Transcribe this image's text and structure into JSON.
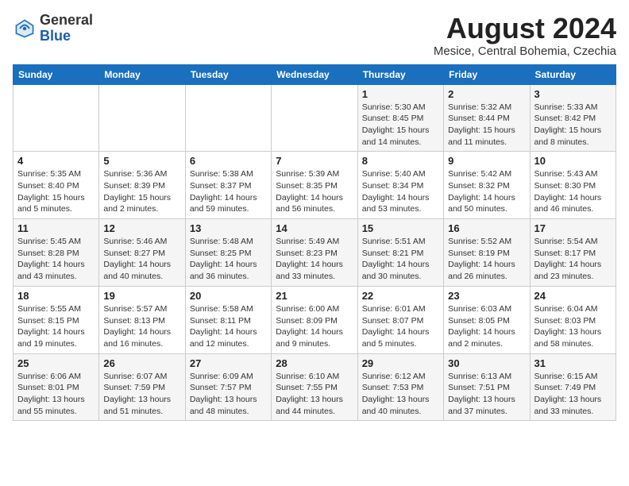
{
  "header": {
    "logo_line1": "General",
    "logo_line2": "Blue",
    "month_year": "August 2024",
    "location": "Mesice, Central Bohemia, Czechia"
  },
  "weekdays": [
    "Sunday",
    "Monday",
    "Tuesday",
    "Wednesday",
    "Thursday",
    "Friday",
    "Saturday"
  ],
  "weeks": [
    [
      {
        "day": "",
        "info": ""
      },
      {
        "day": "",
        "info": ""
      },
      {
        "day": "",
        "info": ""
      },
      {
        "day": "",
        "info": ""
      },
      {
        "day": "1",
        "info": "Sunrise: 5:30 AM\nSunset: 8:45 PM\nDaylight: 15 hours\nand 14 minutes."
      },
      {
        "day": "2",
        "info": "Sunrise: 5:32 AM\nSunset: 8:44 PM\nDaylight: 15 hours\nand 11 minutes."
      },
      {
        "day": "3",
        "info": "Sunrise: 5:33 AM\nSunset: 8:42 PM\nDaylight: 15 hours\nand 8 minutes."
      }
    ],
    [
      {
        "day": "4",
        "info": "Sunrise: 5:35 AM\nSunset: 8:40 PM\nDaylight: 15 hours\nand 5 minutes."
      },
      {
        "day": "5",
        "info": "Sunrise: 5:36 AM\nSunset: 8:39 PM\nDaylight: 15 hours\nand 2 minutes."
      },
      {
        "day": "6",
        "info": "Sunrise: 5:38 AM\nSunset: 8:37 PM\nDaylight: 14 hours\nand 59 minutes."
      },
      {
        "day": "7",
        "info": "Sunrise: 5:39 AM\nSunset: 8:35 PM\nDaylight: 14 hours\nand 56 minutes."
      },
      {
        "day": "8",
        "info": "Sunrise: 5:40 AM\nSunset: 8:34 PM\nDaylight: 14 hours\nand 53 minutes."
      },
      {
        "day": "9",
        "info": "Sunrise: 5:42 AM\nSunset: 8:32 PM\nDaylight: 14 hours\nand 50 minutes."
      },
      {
        "day": "10",
        "info": "Sunrise: 5:43 AM\nSunset: 8:30 PM\nDaylight: 14 hours\nand 46 minutes."
      }
    ],
    [
      {
        "day": "11",
        "info": "Sunrise: 5:45 AM\nSunset: 8:28 PM\nDaylight: 14 hours\nand 43 minutes."
      },
      {
        "day": "12",
        "info": "Sunrise: 5:46 AM\nSunset: 8:27 PM\nDaylight: 14 hours\nand 40 minutes."
      },
      {
        "day": "13",
        "info": "Sunrise: 5:48 AM\nSunset: 8:25 PM\nDaylight: 14 hours\nand 36 minutes."
      },
      {
        "day": "14",
        "info": "Sunrise: 5:49 AM\nSunset: 8:23 PM\nDaylight: 14 hours\nand 33 minutes."
      },
      {
        "day": "15",
        "info": "Sunrise: 5:51 AM\nSunset: 8:21 PM\nDaylight: 14 hours\nand 30 minutes."
      },
      {
        "day": "16",
        "info": "Sunrise: 5:52 AM\nSunset: 8:19 PM\nDaylight: 14 hours\nand 26 minutes."
      },
      {
        "day": "17",
        "info": "Sunrise: 5:54 AM\nSunset: 8:17 PM\nDaylight: 14 hours\nand 23 minutes."
      }
    ],
    [
      {
        "day": "18",
        "info": "Sunrise: 5:55 AM\nSunset: 8:15 PM\nDaylight: 14 hours\nand 19 minutes."
      },
      {
        "day": "19",
        "info": "Sunrise: 5:57 AM\nSunset: 8:13 PM\nDaylight: 14 hours\nand 16 minutes."
      },
      {
        "day": "20",
        "info": "Sunrise: 5:58 AM\nSunset: 8:11 PM\nDaylight: 14 hours\nand 12 minutes."
      },
      {
        "day": "21",
        "info": "Sunrise: 6:00 AM\nSunset: 8:09 PM\nDaylight: 14 hours\nand 9 minutes."
      },
      {
        "day": "22",
        "info": "Sunrise: 6:01 AM\nSunset: 8:07 PM\nDaylight: 14 hours\nand 5 minutes."
      },
      {
        "day": "23",
        "info": "Sunrise: 6:03 AM\nSunset: 8:05 PM\nDaylight: 14 hours\nand 2 minutes."
      },
      {
        "day": "24",
        "info": "Sunrise: 6:04 AM\nSunset: 8:03 PM\nDaylight: 13 hours\nand 58 minutes."
      }
    ],
    [
      {
        "day": "25",
        "info": "Sunrise: 6:06 AM\nSunset: 8:01 PM\nDaylight: 13 hours\nand 55 minutes."
      },
      {
        "day": "26",
        "info": "Sunrise: 6:07 AM\nSunset: 7:59 PM\nDaylight: 13 hours\nand 51 minutes."
      },
      {
        "day": "27",
        "info": "Sunrise: 6:09 AM\nSunset: 7:57 PM\nDaylight: 13 hours\nand 48 minutes."
      },
      {
        "day": "28",
        "info": "Sunrise: 6:10 AM\nSunset: 7:55 PM\nDaylight: 13 hours\nand 44 minutes."
      },
      {
        "day": "29",
        "info": "Sunrise: 6:12 AM\nSunset: 7:53 PM\nDaylight: 13 hours\nand 40 minutes."
      },
      {
        "day": "30",
        "info": "Sunrise: 6:13 AM\nSunset: 7:51 PM\nDaylight: 13 hours\nand 37 minutes."
      },
      {
        "day": "31",
        "info": "Sunrise: 6:15 AM\nSunset: 7:49 PM\nDaylight: 13 hours\nand 33 minutes."
      }
    ]
  ]
}
